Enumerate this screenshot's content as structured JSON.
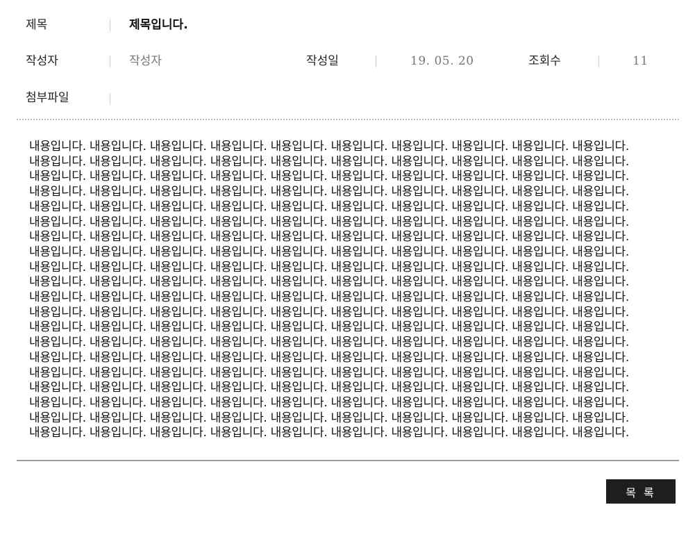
{
  "post": {
    "title_label": "제목",
    "title_value": "제목입니다.",
    "writer_label": "작성자",
    "writer_value": "작성자",
    "date_label": "작성일",
    "date_value": "19. 05. 20",
    "views_label": "조회수",
    "views_value": "11",
    "attachment_label": "첨부파일",
    "attachment_value": "",
    "content_lines": [
      "내용입니다. 내용입니다. 내용입니다. 내용입니다. 내용입니다. 내용입니다. 내용입니다. 내용입니다. 내용입니다. 내용입니다.",
      "내용입니다. 내용입니다. 내용입니다. 내용입니다. 내용입니다. 내용입니다. 내용입니다. 내용입니다. 내용입니다. 내용입니다.",
      "내용입니다. 내용입니다. 내용입니다. 내용입니다. 내용입니다. 내용입니다. 내용입니다. 내용입니다. 내용입니다. 내용입니다.",
      "내용입니다. 내용입니다. 내용입니다. 내용입니다. 내용입니다. 내용입니다. 내용입니다. 내용입니다. 내용입니다. 내용입니다.",
      "내용입니다. 내용입니다. 내용입니다. 내용입니다. 내용입니다. 내용입니다. 내용입니다. 내용입니다. 내용입니다. 내용입니다.",
      "내용입니다. 내용입니다. 내용입니다. 내용입니다. 내용입니다. 내용입니다. 내용입니다. 내용입니다. 내용입니다. 내용입니다.",
      "내용입니다. 내용입니다. 내용입니다. 내용입니다. 내용입니다. 내용입니다. 내용입니다. 내용입니다. 내용입니다. 내용입니다.",
      "내용입니다. 내용입니다. 내용입니다. 내용입니다. 내용입니다. 내용입니다. 내용입니다. 내용입니다. 내용입니다. 내용입니다.",
      "내용입니다. 내용입니다. 내용입니다. 내용입니다. 내용입니다. 내용입니다. 내용입니다. 내용입니다. 내용입니다. 내용입니다.",
      "내용입니다. 내용입니다. 내용입니다. 내용입니다. 내용입니다. 내용입니다. 내용입니다. 내용입니다. 내용입니다. 내용입니다.",
      "내용입니다. 내용입니다. 내용입니다. 내용입니다. 내용입니다. 내용입니다. 내용입니다. 내용입니다. 내용입니다. 내용입니다.",
      "내용입니다. 내용입니다. 내용입니다. 내용입니다. 내용입니다. 내용입니다. 내용입니다. 내용입니다. 내용입니다. 내용입니다.",
      "내용입니다. 내용입니다. 내용입니다. 내용입니다. 내용입니다. 내용입니다. 내용입니다. 내용입니다. 내용입니다. 내용입니다.",
      "내용입니다. 내용입니다. 내용입니다. 내용입니다. 내용입니다. 내용입니다. 내용입니다. 내용입니다. 내용입니다. 내용입니다.",
      "내용입니다. 내용입니다. 내용입니다. 내용입니다. 내용입니다. 내용입니다. 내용입니다. 내용입니다. 내용입니다. 내용입니다.",
      "내용입니다. 내용입니다. 내용입니다. 내용입니다. 내용입니다. 내용입니다. 내용입니다. 내용입니다. 내용입니다. 내용입니다.",
      "내용입니다. 내용입니다. 내용입니다. 내용입니다. 내용입니다. 내용입니다. 내용입니다. 내용입니다. 내용입니다. 내용입니다.",
      "내용입니다. 내용입니다. 내용입니다. 내용입니다. 내용입니다. 내용입니다. 내용입니다. 내용입니다. 내용입니다. 내용입니다.",
      "내용입니다. 내용입니다. 내용입니다. 내용입니다. 내용입니다. 내용입니다. 내용입니다. 내용입니다. 내용입니다. 내용입니다.",
      "내용입니다. 내용입니다. 내용입니다. 내용입니다. 내용입니다. 내용입니다. 내용입니다. 내용입니다. 내용입니다. 내용입니다."
    ]
  },
  "actions": {
    "list_button_label": "목 록"
  },
  "colors": {
    "button_bg": "#1e1e1e",
    "button_text": "#ffffff",
    "label_text": "#222222",
    "value_text": "#777777",
    "divider_solid": "#999999",
    "divider_dotted": "#bdbdbd"
  }
}
